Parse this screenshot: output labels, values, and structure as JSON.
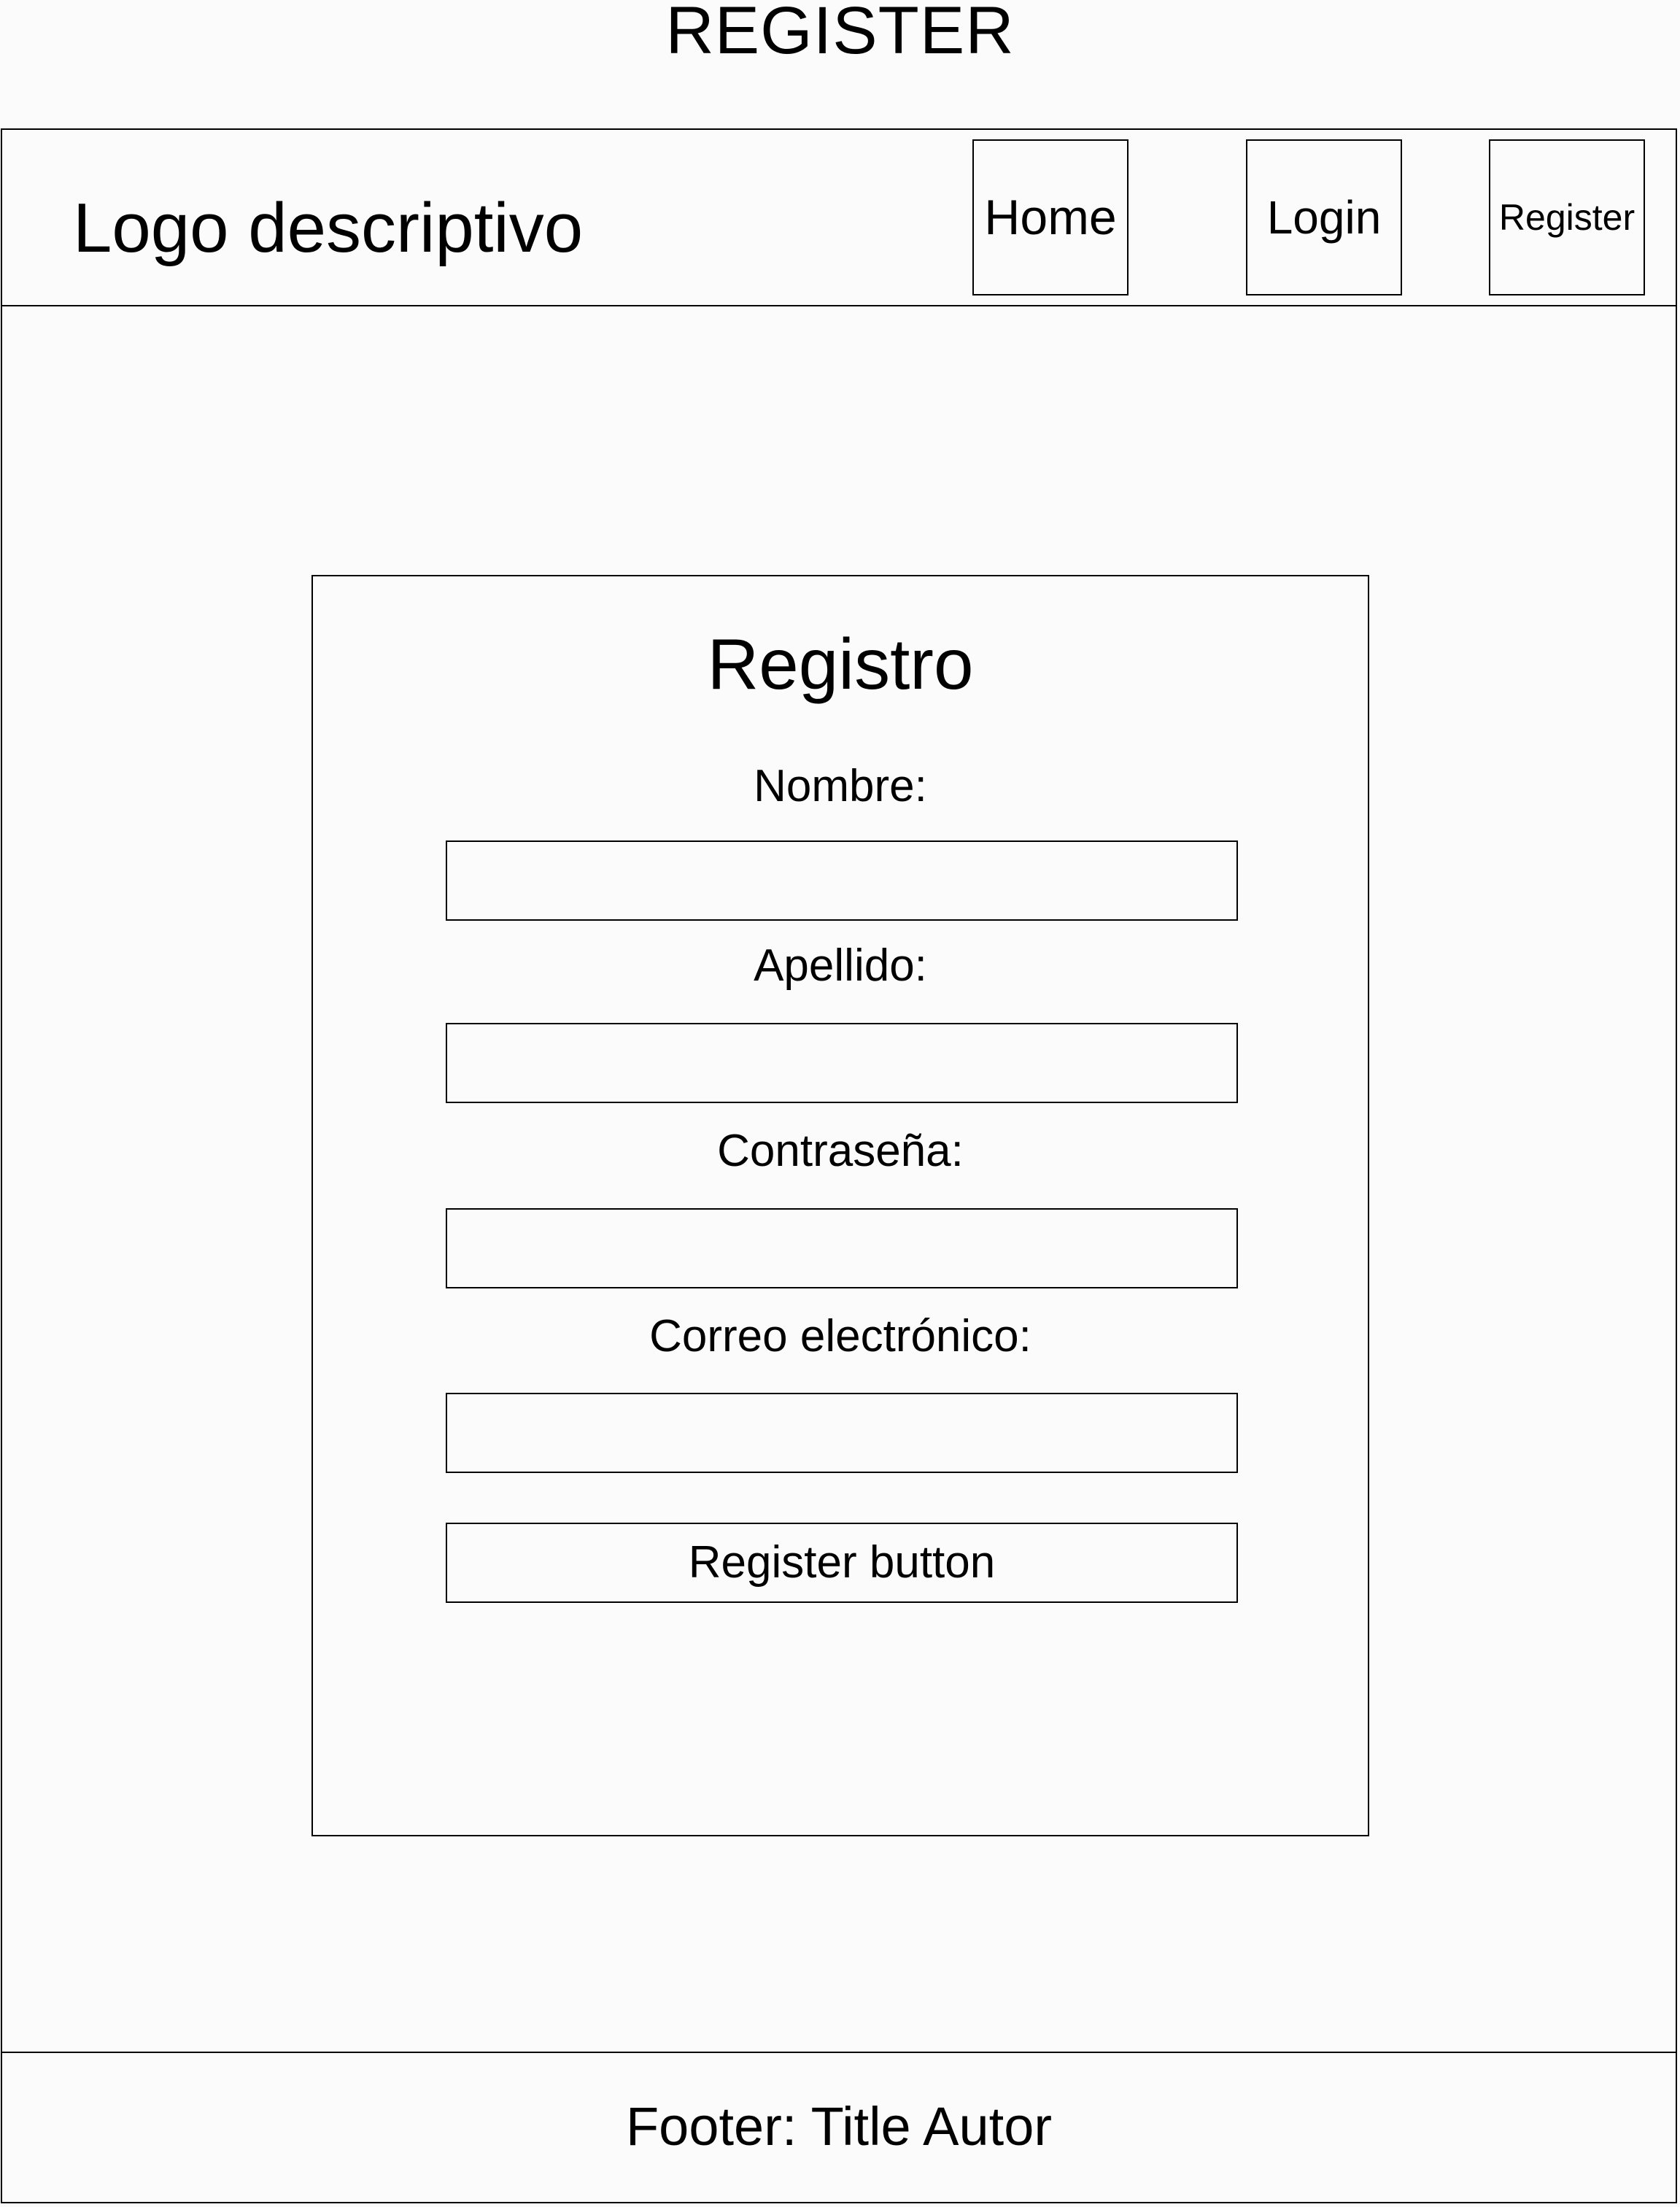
{
  "page": {
    "heading": "REGISTER"
  },
  "header": {
    "logo_text": "Logo descriptivo",
    "nav": {
      "home": "Home",
      "login": "Login",
      "register": "Register"
    }
  },
  "form": {
    "title": "Registro",
    "fields": [
      {
        "label": "Nombre:",
        "value": ""
      },
      {
        "label": "Apellido:",
        "value": ""
      },
      {
        "label": "Contraseña:",
        "value": ""
      },
      {
        "label": "Correo electrónico:",
        "value": ""
      }
    ],
    "submit_label": "Register button"
  },
  "footer": {
    "text": "Footer: Title Autor"
  }
}
